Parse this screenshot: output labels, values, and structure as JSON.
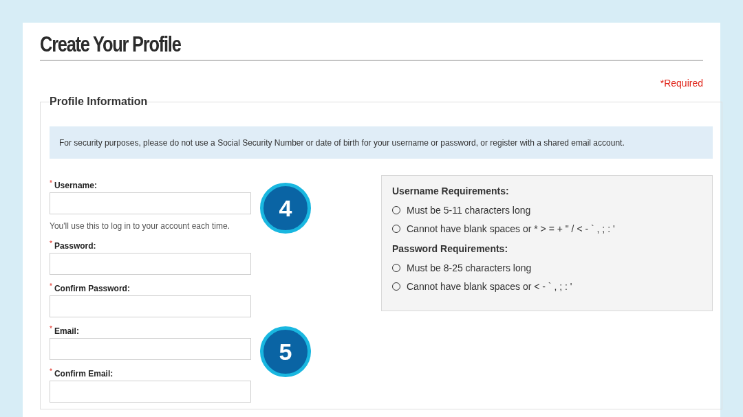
{
  "page": {
    "title": "Create Your Profile",
    "required_note": "*Required"
  },
  "section": {
    "legend": "Profile Information",
    "notice": "For security purposes, please do not use a Social Security Number or date of birth for your username or password, or register with a shared email account."
  },
  "fields": [
    {
      "marker": "*",
      "label": "Username:",
      "hint": "You'll use this to log in to your account each time."
    },
    {
      "marker": "*",
      "label": "Password:"
    },
    {
      "marker": "*",
      "label": "Confirm Password:"
    },
    {
      "marker": "*",
      "label": "Email:"
    },
    {
      "marker": "*",
      "label": "Confirm Email:"
    }
  ],
  "requirements": [
    {
      "heading": "Username Requirements:",
      "items": [
        "Must be 5-11 characters long",
        "Cannot have blank spaces or * > = + \" / < - ` , ; : '"
      ]
    },
    {
      "heading": "Password Requirements:",
      "items": [
        "Must be 8-25 characters long",
        "Cannot have blank spaces or < - ` , ; : '"
      ]
    }
  ],
  "callouts": [
    "4",
    "5"
  ]
}
